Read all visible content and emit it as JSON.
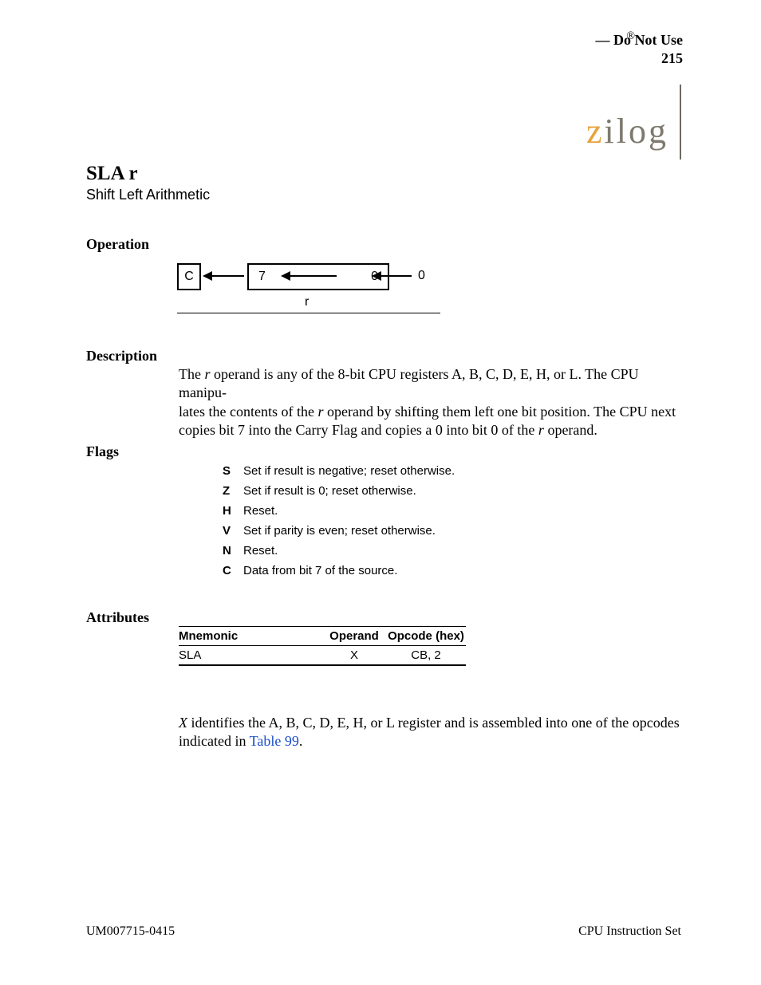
{
  "header": {
    "reg": "®",
    "doc_title": "— Do Not Use",
    "page": "215",
    "logo": "zilog"
  },
  "sla": {
    "heading": "SLA r",
    "sub": "Shift Left Arithmetic"
  },
  "op": {
    "heading": "Operation"
  },
  "diagram": {
    "c": "C",
    "seven": "7",
    "zero_inner": "0",
    "zero_in": "0",
    "r": "r"
  },
  "desc": {
    "heading": "Description",
    "p1a": "The ",
    "p1b": "r",
    "p1c": " operand is any of the 8-bit CPU registers A, B, C, D, E, H, or L. The CPU manipu-",
    "p2a": "lates the contents of the ",
    "p2b": "r",
    "p2c": " operand by shifting them left one bit position. The CPU next",
    "p3a": "copies bit 7 into the Carry Flag and copies a 0 into bit 0 of the ",
    "p3b": "r",
    "p3c": " operand."
  },
  "flags": {
    "heading": "Flags",
    "rows": [
      {
        "f": "S",
        "t": "Set if result is negative; reset otherwise."
      },
      {
        "f": "Z",
        "t": "Set if result is 0; reset otherwise."
      },
      {
        "f": "H",
        "t": "Reset."
      },
      {
        "f": "V",
        "t": "Set if parity is even; reset otherwise."
      },
      {
        "f": "N",
        "t": "Reset."
      },
      {
        "f": "C",
        "t": "Data from bit 7 of the source."
      }
    ]
  },
  "attr": {
    "heading": "Attributes",
    "h1": "Mnemonic",
    "h2": "Operand",
    "h3": "Opcode (hex)",
    "d1": "SLA",
    "d2": "X",
    "d3": "CB, 2",
    "xref": "X"
  },
  "body2": {
    "p1a": " identifies the A, B, C, D, E, H, or L register and is assembled into one of the opcodes",
    "p2a": "indicated in ",
    "p2b": "Table 99",
    "p2c": "."
  },
  "footer": {
    "left": "UM007715-0415",
    "right": "CPU Instruction Set"
  }
}
